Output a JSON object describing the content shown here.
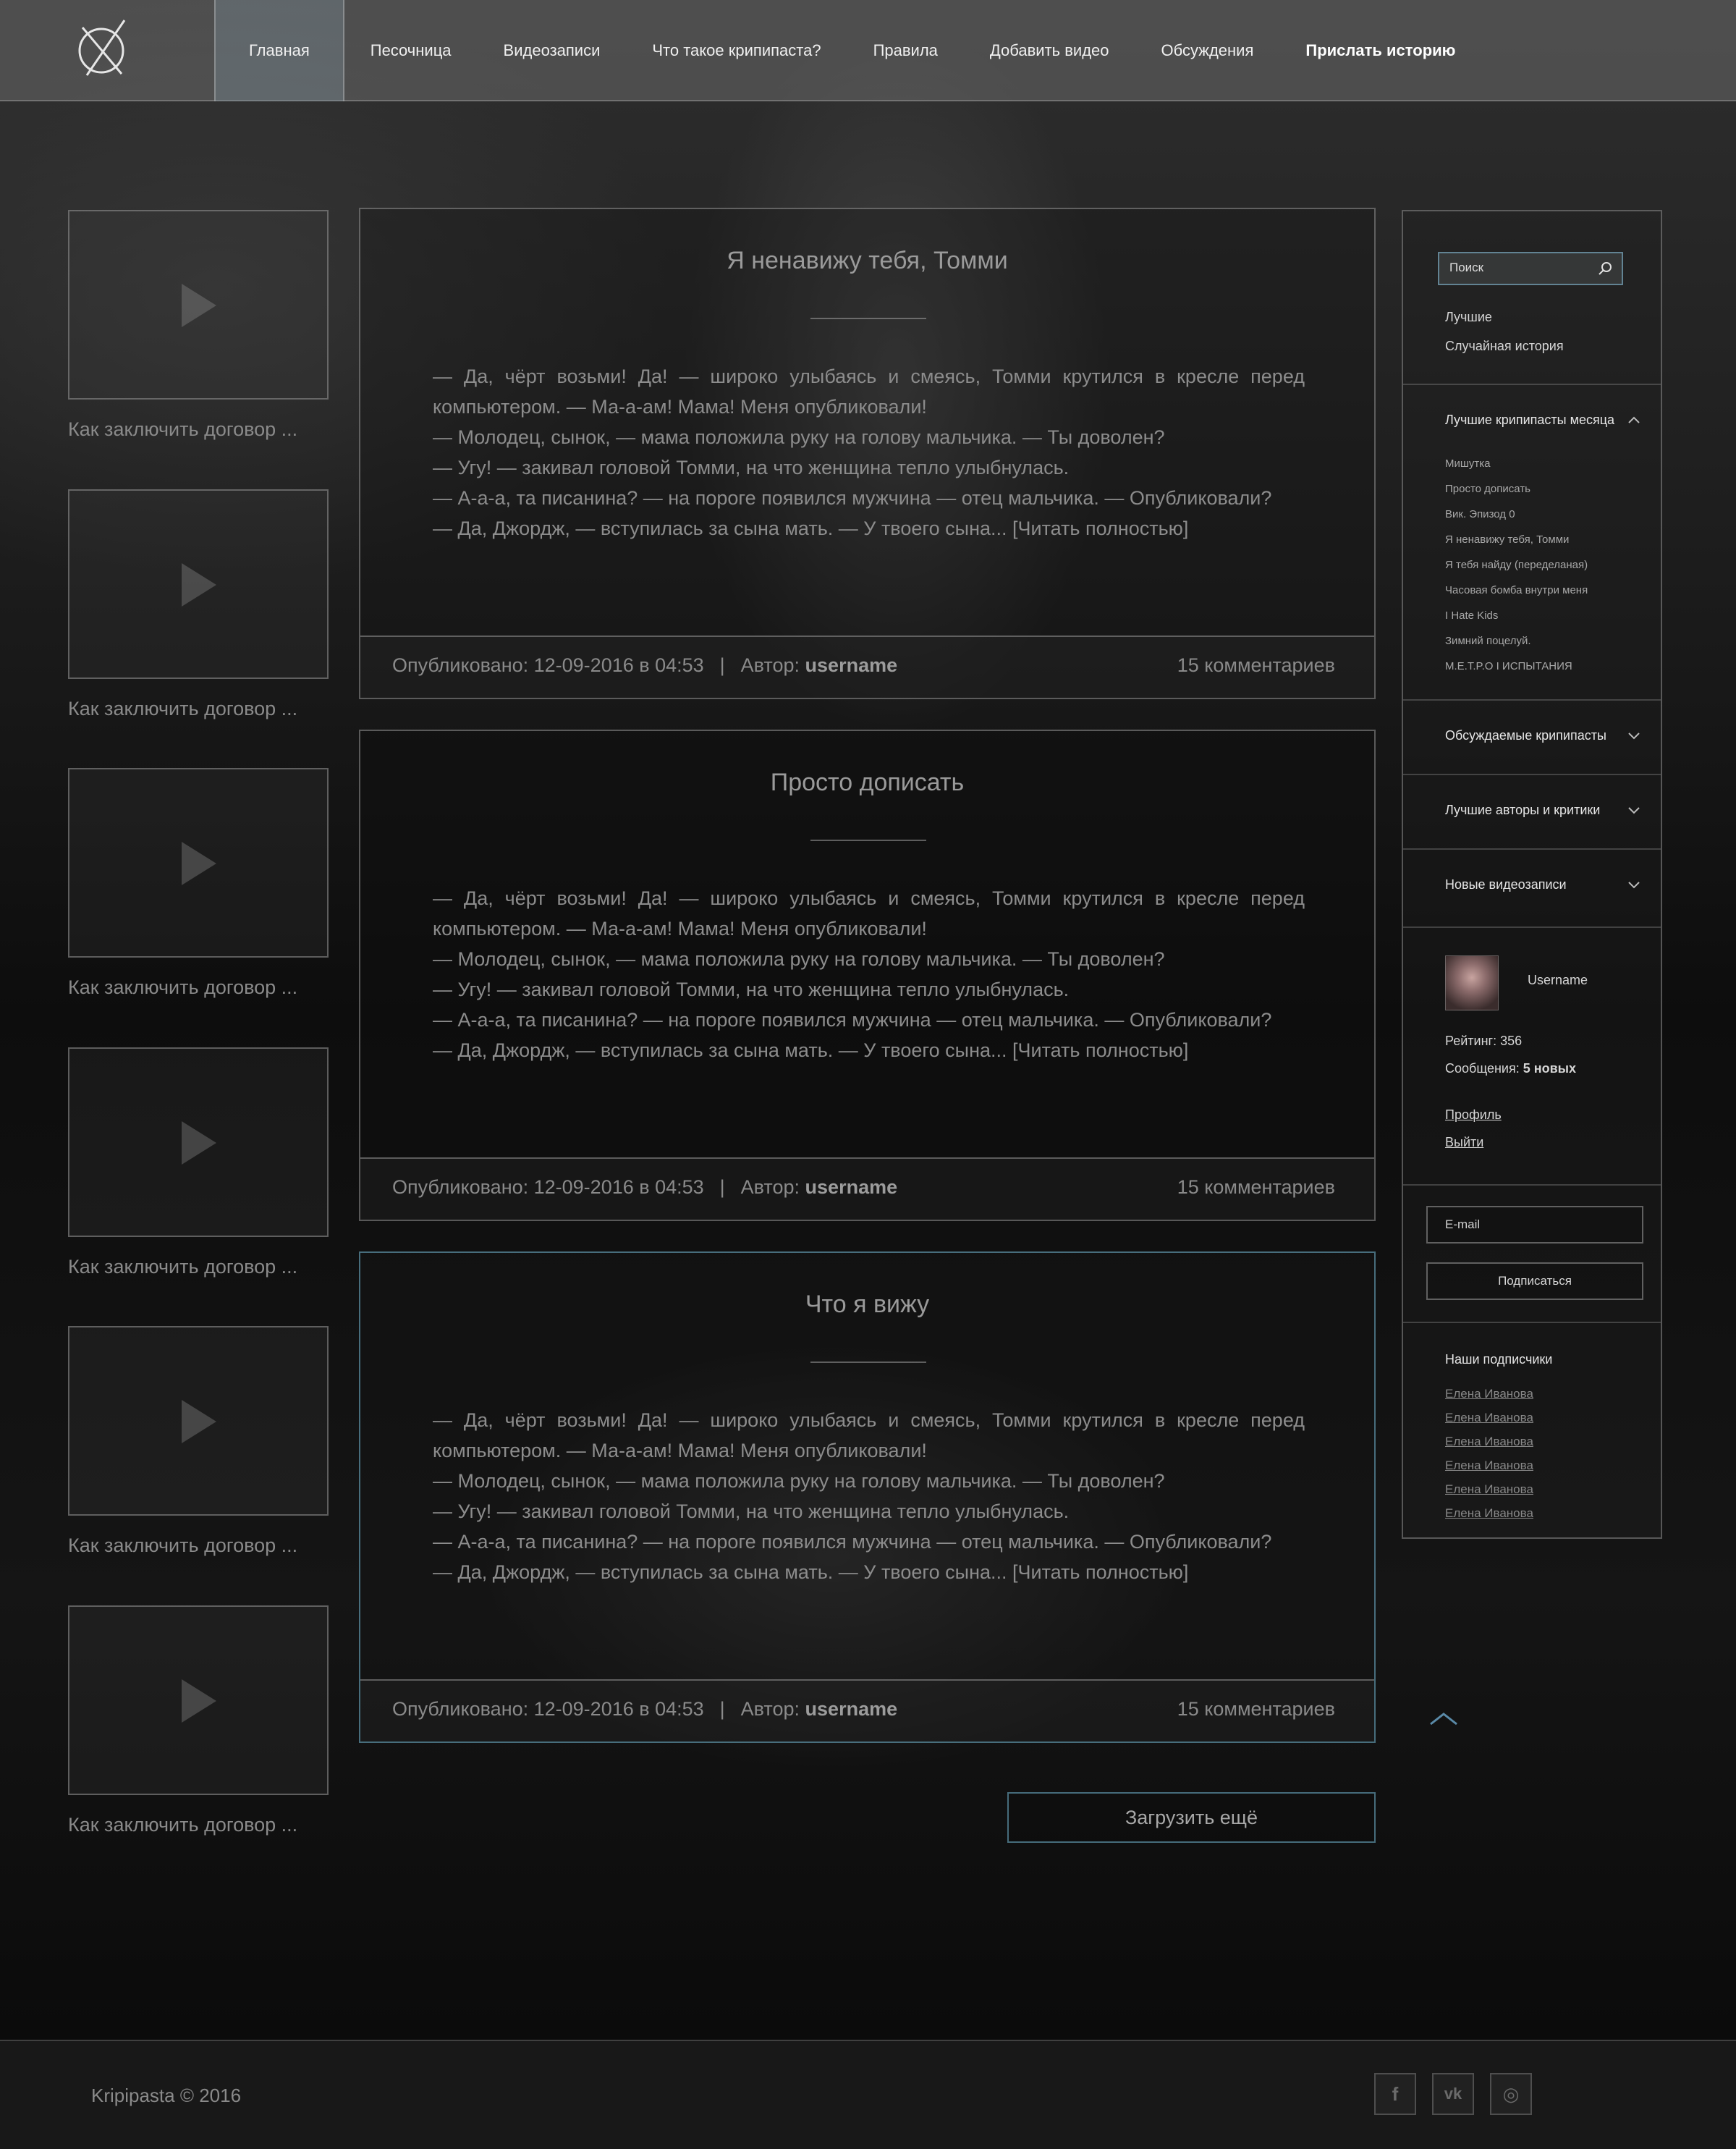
{
  "nav": {
    "items": [
      {
        "label": "Главная",
        "active": true
      },
      {
        "label": "Песочница"
      },
      {
        "label": "Видеозаписи"
      },
      {
        "label": "Что такое крипипаста?"
      },
      {
        "label": "Правила"
      },
      {
        "label": "Добавить видео"
      },
      {
        "label": "Обсуждения"
      },
      {
        "label": "Прислать историю",
        "bold": true
      }
    ]
  },
  "videos": [
    {
      "title": "Как заключить договор ..."
    },
    {
      "title": "Как заключить договор ..."
    },
    {
      "title": "Как заключить договор ..."
    },
    {
      "title": "Как заключить договор ..."
    },
    {
      "title": "Как заключить договор ..."
    },
    {
      "title": "Как заключить договор ..."
    }
  ],
  "posts": [
    {
      "title": "Я ненавижу тебя, Томми",
      "lines": [
        "— Да, чёрт возьми! Да! — широко улыбаясь и смеясь, Томми крутился в кресле перед компьютером. — Ма-а-ам! Мама! Меня опубликовали!",
        "— Молодец, сынок, — мама положила руку на голову мальчика. — Ты доволен?",
        "— Угу! — закивал головой Томми, на что женщина тепло улыбнулась.",
        "— А-а-а, та писанина? — на пороге появился мужчина — отец мальчика. — Опубликовали?",
        "— Да, Джордж, — вступилась за сына мать. — У твоего сына... [Читать полностью]"
      ],
      "published": "Опубликовано: 12-09-2016 в 04:53",
      "separator": "|",
      "author_label": "Автор:",
      "author": "username",
      "comments": "15 комментариев"
    },
    {
      "title": "Просто дописать",
      "lines": [
        "— Да, чёрт возьми! Да! — широко улыбаясь и смеясь, Томми крутился в кресле перед компьютером. — Ма-а-ам! Мама! Меня опубликовали!",
        "— Молодец, сынок, — мама положила руку на голову мальчика. — Ты доволен?",
        "— Угу! — закивал головой Томми, на что женщина тепло улыбнулась.",
        "— А-а-а, та писанина? — на пороге появился мужчина — отец мальчика. — Опубликовали?",
        "— Да, Джордж, — вступилась за сына мать. — У твоего сына... [Читать полностью]"
      ],
      "published": "Опубликовано: 12-09-2016 в 04:53",
      "separator": "|",
      "author_label": "Автор:",
      "author": "username",
      "comments": "15 комментариев"
    },
    {
      "title": "Что я вижу",
      "lines": [
        "— Да, чёрт возьми! Да! — широко улыбаясь и смеясь, Томми крутился в кресле перед компьютером. — Ма-а-ам! Мама! Меня опубликовали!",
        "— Молодец, сынок, — мама положила руку на голову мальчика. — Ты доволен?",
        "— Угу! — закивал головой Томми, на что женщина тепло улыбнулась.",
        "— А-а-а, та писанина? — на пороге появился мужчина — отец мальчика. — Опубликовали?",
        "— Да, Джордж, — вступилась за сына мать. — У твоего сына... [Читать полностью]"
      ],
      "published": "Опубликовано: 12-09-2016 в 04:53",
      "separator": "|",
      "author_label": "Автор:",
      "author": "username",
      "comments": "15 комментариев"
    }
  ],
  "load_more": "Загрузить ещё",
  "sidebar": {
    "search_placeholder": "Поиск",
    "links": [
      "Лучшие",
      "Случайная история"
    ],
    "best_month": {
      "heading": "Лучшие крипипасты месяца",
      "items": [
        "Мишутка",
        "Просто дописать",
        "Вик. Эпизод 0",
        "Я ненавижу тебя, Томми",
        "Я тебя найду (переделаная)",
        "Часовая бомба внутри меня",
        "I Hate Kids",
        "Зимний поцелуй.",
        "M.E.T.P.O I ИСПЫТАНИЯ"
      ]
    },
    "collapsed_sections": [
      "Обсуждаемые крипипасты",
      "Лучшие авторы и критики",
      "Новые видеозаписи"
    ],
    "user": {
      "name": "Username",
      "rating": "Рейтинг: 356",
      "messages_label": "Сообщения:",
      "messages_value": "5 новых",
      "profile_link": "Профиль",
      "logout_link": "Выйти"
    },
    "subscribe": {
      "email_placeholder": "E-mail",
      "button": "Подписаться"
    },
    "subscribers": {
      "heading": "Наши подписчики",
      "names": [
        "Елена Иванова",
        "Елена Иванова",
        "Елена Иванова",
        "Елена Иванова",
        "Елена Иванова",
        "Елена Иванова"
      ]
    }
  },
  "footer": {
    "copyright": "Kripipasta © 2016",
    "social_icons": [
      "facebook-icon",
      "vk-icon",
      "instagram-icon"
    ],
    "social_glyphs": [
      "f",
      "vk",
      "◎"
    ]
  }
}
